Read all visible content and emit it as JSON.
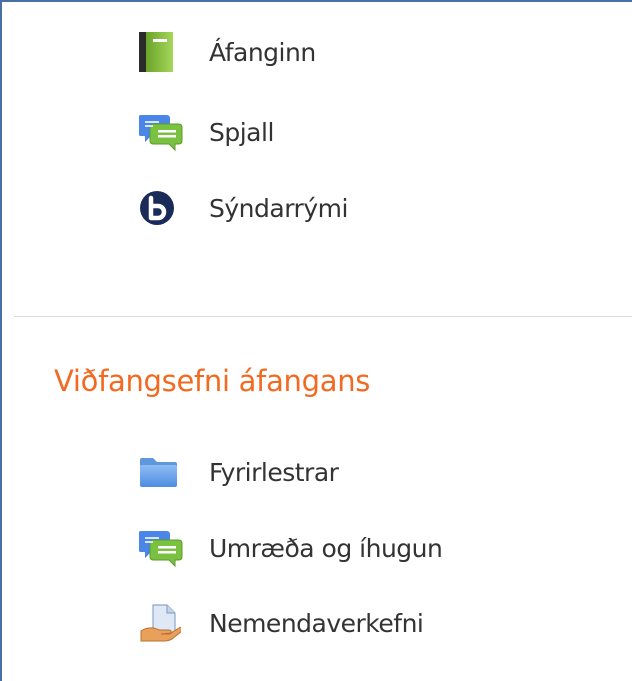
{
  "top_section": {
    "items": [
      {
        "label": "Áfanginn",
        "icon": "book-icon"
      },
      {
        "label": "Spjall",
        "icon": "chat-icon"
      },
      {
        "label": "Sýndarrými",
        "icon": "bigbluebutton-icon"
      }
    ]
  },
  "course_section": {
    "title": "Viðfangsefni áfangans",
    "items": [
      {
        "label": "Fyrirlestrar",
        "icon": "folder-icon"
      },
      {
        "label": "Umræða og íhugun",
        "icon": "chat-icon"
      },
      {
        "label": "Nemendaverkefni",
        "icon": "assignment-icon"
      }
    ]
  },
  "colors": {
    "section_title": "#f26a21",
    "text": "#333333",
    "frame_border": "#4a6fa5",
    "divider": "#dcdcdc"
  }
}
